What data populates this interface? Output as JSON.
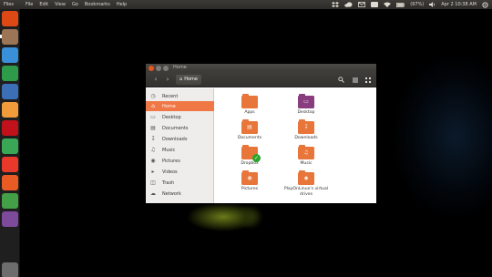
{
  "top_panel": {
    "app_name": "Files",
    "menus": [
      "File",
      "Edit",
      "View",
      "Go",
      "Bookmarks",
      "Help"
    ],
    "battery": "(97%)",
    "clock": "Apr 2 10:38 AM"
  },
  "launcher": {
    "items": [
      {
        "icon": "ubuntu-dash-icon",
        "color": "#dd4814"
      },
      {
        "icon": "files-icon",
        "color": "#9b7556"
      },
      {
        "icon": "writer-icon",
        "color": "#3a8fd9"
      },
      {
        "icon": "calc-icon",
        "color": "#2e9b4a"
      },
      {
        "icon": "firefox-icon",
        "color": "#3b6fb6"
      },
      {
        "icon": "software-center-icon",
        "color": "#f19b3b"
      },
      {
        "icon": "lens-icon",
        "color": "#c1121c"
      },
      {
        "icon": "chrome-icon",
        "color": "#3aa757"
      },
      {
        "icon": "app-red-icon",
        "color": "#e8392a"
      },
      {
        "icon": "impress-icon",
        "color": "#ea5b24"
      },
      {
        "icon": "app-green-icon",
        "color": "#43a047"
      },
      {
        "icon": "app-purple-icon",
        "color": "#7e4a9b"
      },
      {
        "icon": "trash-icon",
        "color": "#6d6d6d"
      }
    ]
  },
  "window": {
    "title": "Home",
    "location": "Home",
    "accent": "#f07746",
    "sidebar": [
      {
        "label": "Recent",
        "icon": "clock-icon"
      },
      {
        "label": "Home",
        "icon": "home-icon",
        "active": true
      },
      {
        "label": "Desktop",
        "icon": "desktop-icon"
      },
      {
        "label": "Documents",
        "icon": "document-icon"
      },
      {
        "label": "Downloads",
        "icon": "download-icon"
      },
      {
        "label": "Music",
        "icon": "music-icon"
      },
      {
        "label": "Pictures",
        "icon": "camera-icon"
      },
      {
        "label": "Videos",
        "icon": "video-icon"
      },
      {
        "label": "Trash",
        "icon": "trash-icon"
      },
      {
        "label": "Network",
        "icon": "network-icon"
      }
    ],
    "folders": [
      {
        "label": "Apps",
        "color": "#e8763a"
      },
      {
        "label": "Desktop",
        "color": "#8a3d7e"
      },
      {
        "label": "Documents",
        "color": "#e8763a"
      },
      {
        "label": "Downloads",
        "color": "#e8763a"
      },
      {
        "label": "Dropbox",
        "color": "#e8763a"
      },
      {
        "label": "Music",
        "color": "#e8763a"
      },
      {
        "label": "Pictures",
        "color": "#e8763a"
      },
      {
        "label": "PlayOnLinux's virtual drives",
        "color": "#e8763a"
      }
    ]
  }
}
